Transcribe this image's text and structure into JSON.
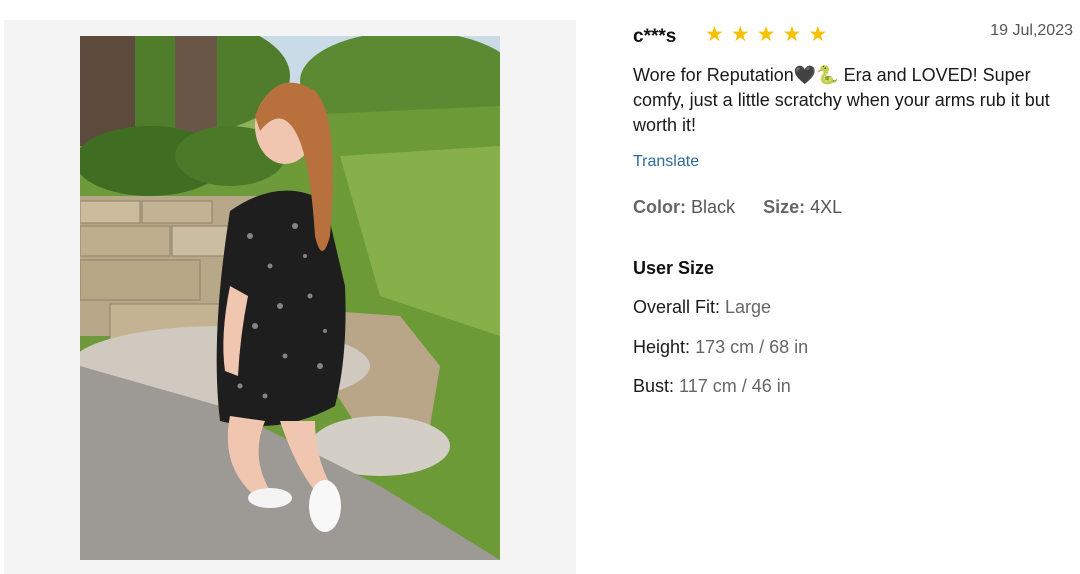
{
  "review": {
    "reviewer": "c***s",
    "rating": 5,
    "stars": [
      "★",
      "★",
      "★",
      "★",
      "★"
    ],
    "date": "19 Jul,2023",
    "text": "Wore for Reputation🖤🐍 Era and LOVED! Super comfy, just a little scratchy when your arms rub it but worth it!",
    "translate_label": "Translate",
    "color_label": "Color:",
    "color_value": "Black",
    "size_label": "Size:",
    "size_value": "4XL"
  },
  "user_size": {
    "title": "User Size",
    "fit_label": "Overall Fit:",
    "fit_value": "Large",
    "height_label": "Height:",
    "height_value": "173 cm / 68 in",
    "bust_label": "Bust:",
    "bust_value": "117 cm / 46 in"
  },
  "colors": {
    "star": "#f6c200",
    "link": "#2d6a9f"
  }
}
